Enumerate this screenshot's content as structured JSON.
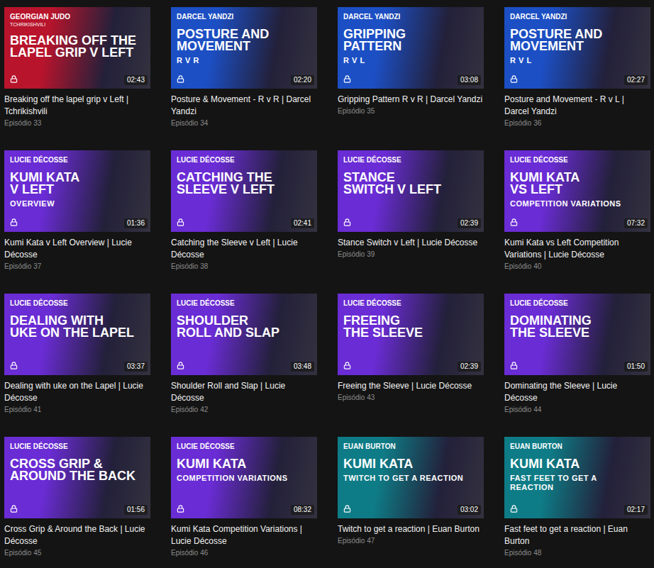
{
  "cards": [
    {
      "brand": "GEORGIAN JUDO",
      "brand_sub": "TCHRIKISHVILI",
      "title_lines": [
        "BREAKING OFF THE",
        "LAPEL GRIP V LEFT"
      ],
      "duration": "02:43",
      "locked": true,
      "color": "#b8142c",
      "name": "Breaking off the lapel grip v Left | Tchrikishvili",
      "episode": "Episódio 33"
    },
    {
      "brand": "DARCEL YANDZI",
      "title_lines": [
        "POSTURE AND",
        "MOVEMENT"
      ],
      "subtitle": "R V R",
      "duration": "02:20",
      "locked": true,
      "color": "#1c4fc4",
      "name": "Posture & Movement - R v R | Darcel Yandzi",
      "episode": "Episódio 34"
    },
    {
      "brand": "DARCEL YANDZI",
      "title_lines": [
        "GRIPPING",
        "PATTERN"
      ],
      "subtitle": "R V L",
      "duration": "03:08",
      "locked": true,
      "color": "#1c4fc4",
      "name": "Gripping Pattern R v R | Darcel Yandzi",
      "episode": "Episódio 35"
    },
    {
      "brand": "DARCEL YANDZI",
      "title_lines": [
        "POSTURE AND",
        "MOVEMENT"
      ],
      "subtitle": "R V L",
      "duration": "02:27",
      "locked": true,
      "color": "#1c4fc4",
      "name": "Posture and Movement - R v L | Darcel Yandzi",
      "episode": "Episódio 36"
    },
    {
      "brand": "LUCIE DÉCOSSE",
      "title_lines": [
        "KUMI KATA",
        "V LEFT"
      ],
      "subtitle": "OVERVIEW",
      "duration": "01:36",
      "locked": true,
      "color": "#6a2cd4",
      "name": "Kumi Kata v Left Overview | Lucie Décosse",
      "episode": "Episódio 37"
    },
    {
      "brand": "LUCIE DÉCOSSE",
      "title_lines": [
        "CATCHING THE",
        "SLEEVE V LEFT"
      ],
      "duration": "02:41",
      "locked": true,
      "color": "#6a2cd4",
      "name": "Catching the Sleeve v Left | Lucie Décosse",
      "episode": "Episódio 38"
    },
    {
      "brand": "LUCIE DÉCOSSE",
      "title_lines": [
        "STANCE",
        "SWITCH V LEFT"
      ],
      "duration": "02:39",
      "locked": true,
      "color": "#6a2cd4",
      "name": "Stance Switch v Left | Lucie Décosse",
      "episode": "Episódio 39"
    },
    {
      "brand": "LUCIE DÉCOSSE",
      "title_lines": [
        "KUMI KATA",
        "VS LEFT"
      ],
      "subtitle": "COMPETITION VARIATIONS",
      "duration": "07:32",
      "locked": true,
      "color": "#6a2cd4",
      "name": "Kumi Kata vs Left Competition Variations | Lucie Décosse",
      "episode": "Episódio 40"
    },
    {
      "brand": "LUCIE DÉCOSSE",
      "title_lines": [
        "DEALING WITH",
        "UKE ON THE LAPEL"
      ],
      "duration": "03:37",
      "locked": true,
      "color": "#6a2cd4",
      "name": "Dealing with uke on the Lapel | Lucie Décosse",
      "episode": "Episódio 41"
    },
    {
      "brand": "LUCIE DÉCOSSE",
      "title_lines": [
        "SHOULDER",
        "ROLL AND SLAP"
      ],
      "duration": "03:48",
      "locked": true,
      "color": "#6a2cd4",
      "name": "Shoulder Roll and Slap | Lucie Décosse",
      "episode": "Episódio 42"
    },
    {
      "brand": "LUCIE DÉCOSSE",
      "title_lines": [
        "FREEING",
        "THE SLEEVE"
      ],
      "duration": "02:39",
      "locked": true,
      "color": "#6a2cd4",
      "name": "Freeing the Sleeve | Lucie Décosse",
      "episode": "Episódio 43"
    },
    {
      "brand": "LUCIE DÉCOSSE",
      "title_lines": [
        "DOMINATING",
        "THE SLEEVE"
      ],
      "duration": "01:50",
      "locked": true,
      "color": "#6a2cd4",
      "name": "Dominating the Sleeve | Lucie Décosse",
      "episode": "Episódio 44"
    },
    {
      "brand": "LUCIE DÉCOSSE",
      "title_lines": [
        "CROSS GRIP &",
        "AROUND THE BACK"
      ],
      "duration": "01:56",
      "locked": true,
      "color": "#6a2cd4",
      "name": "Cross Grip & Around the Back | Lucie Décosse",
      "episode": "Episódio 45"
    },
    {
      "brand": "LUCIE DÉCOSSE",
      "title_lines": [
        "KUMI KATA"
      ],
      "subtitle": "COMPETITION VARIATIONS",
      "duration": "08:32",
      "locked": true,
      "color": "#6a2cd4",
      "name": "Kumi Kata Competition Variations | Lucie Décosse",
      "episode": "Episódio 46"
    },
    {
      "brand": "EUAN BURTON",
      "title_lines": [
        "KUMI KATA"
      ],
      "subtitle": "TWITCH TO GET A REACTION",
      "duration": "03:02",
      "locked": true,
      "color": "#0e7c86",
      "name": "Twitch to get a reaction | Euan Burton",
      "episode": "Episódio 47"
    },
    {
      "brand": "EUAN BURTON",
      "title_lines": [
        "KUMI KATA"
      ],
      "subtitle": "FAST FEET TO GET A REACTION",
      "duration": "02:17",
      "locked": true,
      "color": "#0e7c86",
      "name": "Fast feet to get a reaction | Euan Burton",
      "episode": "Episódio 48"
    }
  ]
}
